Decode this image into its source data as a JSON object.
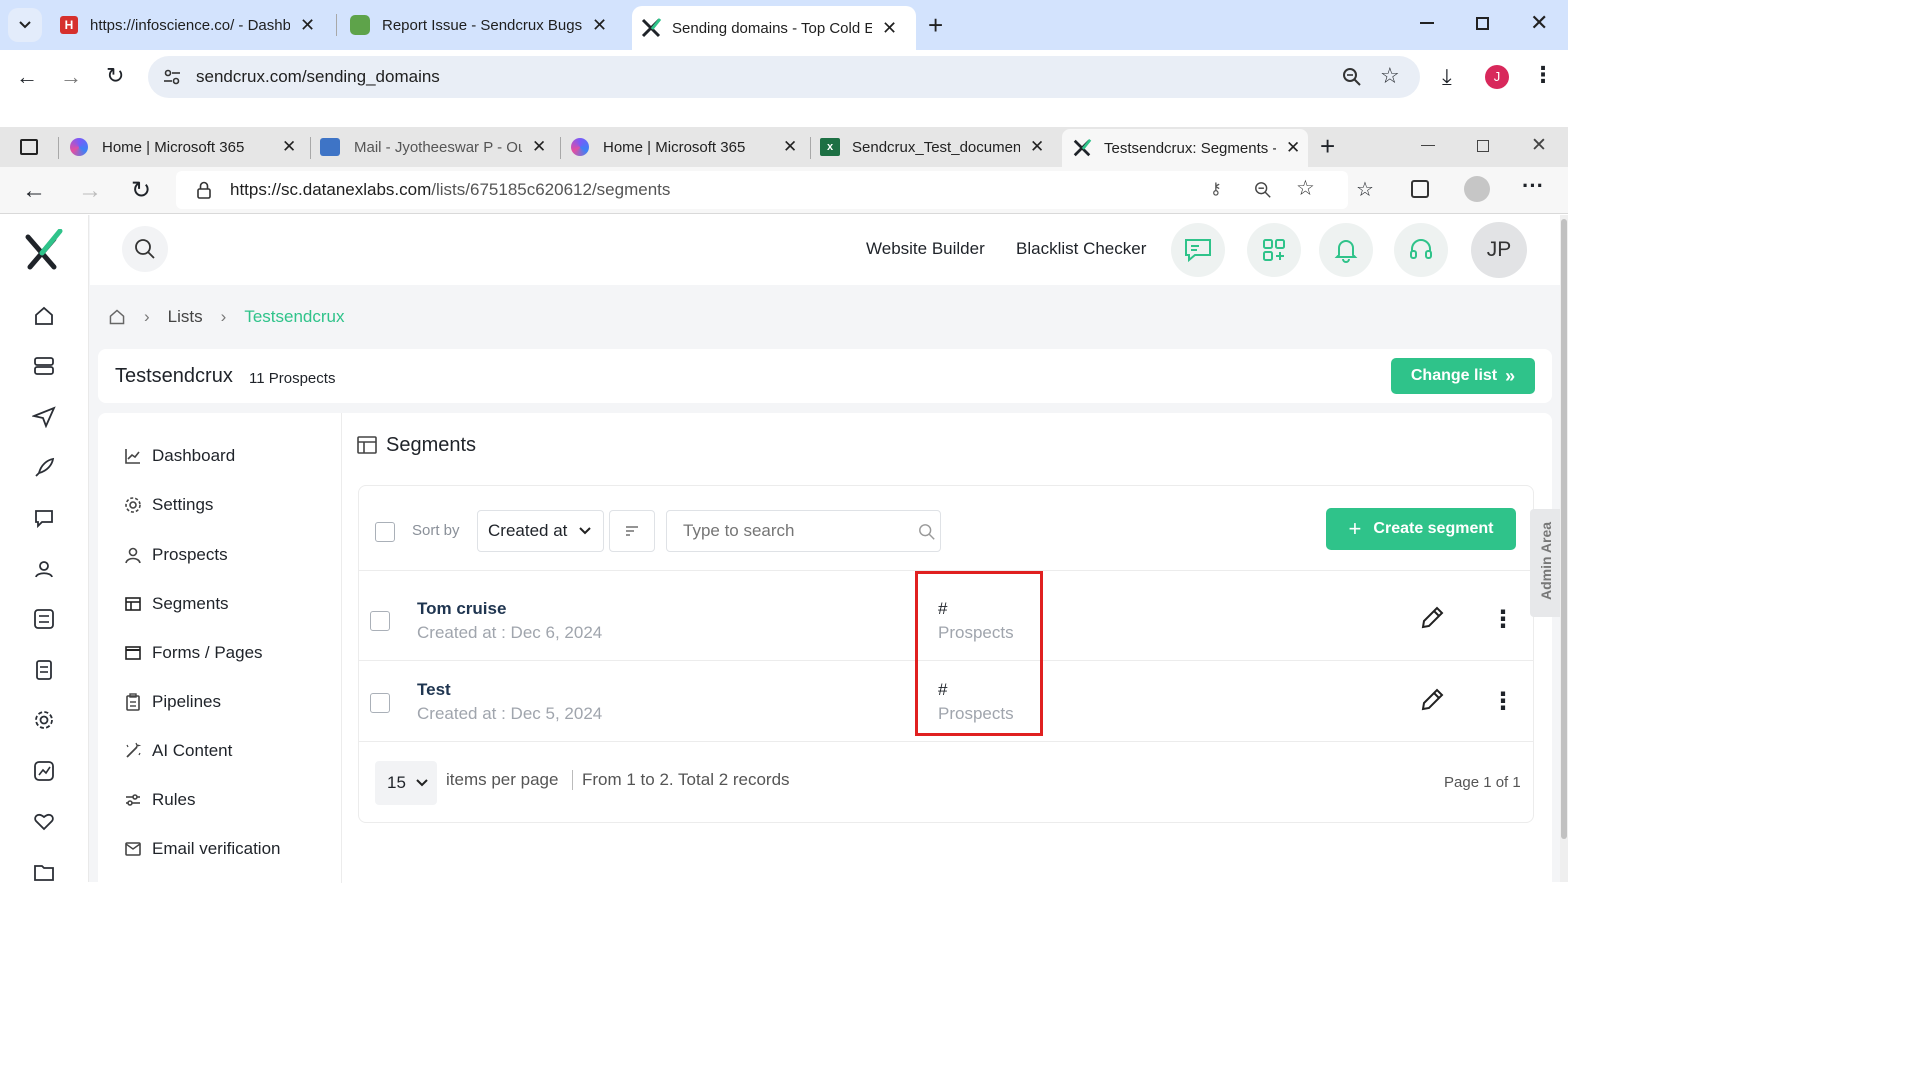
{
  "outer_browser": {
    "tabs": [
      {
        "title": "https://infoscience.co/ - Dashbo"
      },
      {
        "title": "Report Issue - Sendcrux Bugs Tr"
      },
      {
        "title": "Sending domains - Top Cold Em"
      }
    ],
    "url": "sendcrux.com/sending_domains",
    "profile_initial": "J"
  },
  "inner_browser": {
    "tabs": [
      {
        "title": "Home | Microsoft 365"
      },
      {
        "title": "Mail - Jyotheeswar P - Out"
      },
      {
        "title": "Home | Microsoft 365"
      },
      {
        "title": "Sendcrux_Test_document."
      },
      {
        "title": "Testsendcrux: Segments -"
      }
    ],
    "url_host": "https://sc.datanexlabs.com",
    "url_path": "/lists/675185c620612/segments"
  },
  "header": {
    "links": [
      "Website Builder",
      "Blacklist Checker"
    ],
    "avatar": "JP"
  },
  "breadcrumb": {
    "items": [
      "Lists",
      "Testsendcrux"
    ]
  },
  "list_header": {
    "name": "Testsendcrux",
    "count": "11",
    "count_label": "Prospects",
    "change_list": "Change list"
  },
  "side_menu": [
    {
      "label": "Dashboard",
      "icon": "chart-line-icon"
    },
    {
      "label": "Settings",
      "icon": "gear-icon"
    },
    {
      "label": "Prospects",
      "icon": "user-icon"
    },
    {
      "label": "Segments",
      "icon": "table-icon"
    },
    {
      "label": "Forms / Pages",
      "icon": "window-icon"
    },
    {
      "label": "Pipelines",
      "icon": "clipboard-icon"
    },
    {
      "label": "AI Content",
      "icon": "magic-wand-icon"
    },
    {
      "label": "Rules",
      "icon": "sliders-icon"
    },
    {
      "label": "Email verification",
      "icon": "mail-check-icon"
    }
  ],
  "segments": {
    "title": "Segments",
    "sort_by": "Sort by",
    "sort_value": "Created at",
    "search_placeholder": "Type to search",
    "create_button": "Create segment",
    "rows": [
      {
        "name": "Tom cruise",
        "created": "Created at : Dec 6, 2024",
        "hash": "#",
        "prospects": "Prospects"
      },
      {
        "name": "Test",
        "created": "Created at : Dec 5, 2024",
        "hash": "#",
        "prospects": "Prospects"
      }
    ],
    "per_page": "15",
    "per_page_label": "items per page",
    "range_text": "From 1 to 2. Total 2 records",
    "page_text": "Page 1 of 1"
  },
  "admin_tab": "Admin Area",
  "colors": {
    "accent": "#2fc38a",
    "highlight": "#e02020",
    "outer_chrome": "#d3e3fd"
  }
}
